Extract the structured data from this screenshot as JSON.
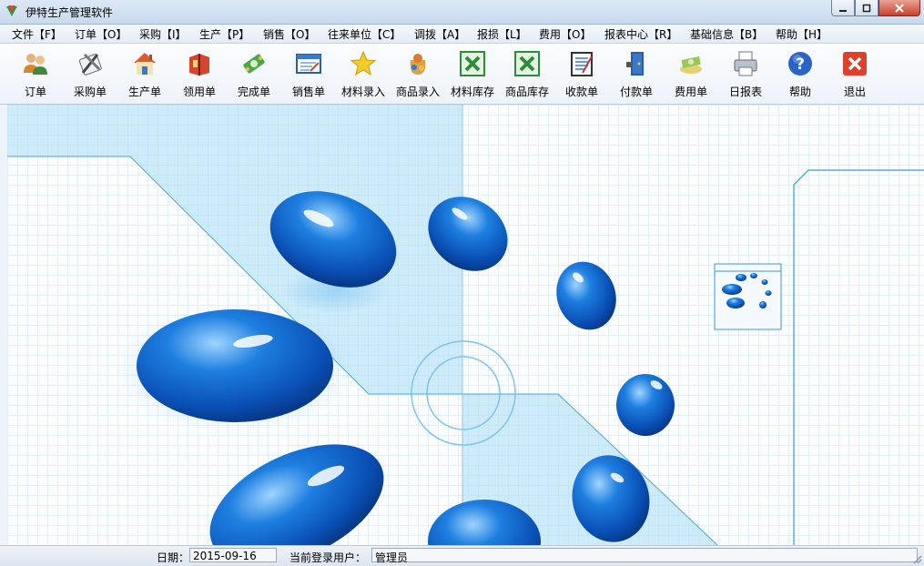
{
  "window": {
    "title": "伊特生产管理软件"
  },
  "menu": [
    "文件【F】",
    "订单【O】",
    "采购【I】",
    "生产【P】",
    "销售【O】",
    "往来单位【C】",
    "调拨【A】",
    "报损【L】",
    "费用【O】",
    "报表中心【R】",
    "基础信息【B】",
    "帮助【H】"
  ],
  "toolbar": [
    {
      "label": "订单",
      "icon": "users-icon"
    },
    {
      "label": "采购单",
      "icon": "tools-icon"
    },
    {
      "label": "生产单",
      "icon": "house-icon"
    },
    {
      "label": "领用单",
      "icon": "book-icon"
    },
    {
      "label": "完成单",
      "icon": "money-icon"
    },
    {
      "label": "销售单",
      "icon": "form-icon"
    },
    {
      "label": "材料录入",
      "icon": "star-icon"
    },
    {
      "label": "商品录入",
      "icon": "bag-icon"
    },
    {
      "label": "材料库存",
      "icon": "excel-icon"
    },
    {
      "label": "商品库存",
      "icon": "excel-icon"
    },
    {
      "label": "收款单",
      "icon": "notepad-icon"
    },
    {
      "label": "付款单",
      "icon": "door-icon"
    },
    {
      "label": "费用单",
      "icon": "cash-icon"
    },
    {
      "label": "日报表",
      "icon": "printer-icon"
    },
    {
      "label": "帮助",
      "icon": "help-icon"
    },
    {
      "label": "退出",
      "icon": "exit-icon"
    }
  ],
  "status": {
    "date_label": "日期：",
    "date_value": "2015-09-16",
    "user_label": "当前登录用户：",
    "user_value": "管理员"
  },
  "colors": {
    "accent": "#1a73c8",
    "exit_red": "#e0402a",
    "excel_green": "#2e8b3a"
  }
}
